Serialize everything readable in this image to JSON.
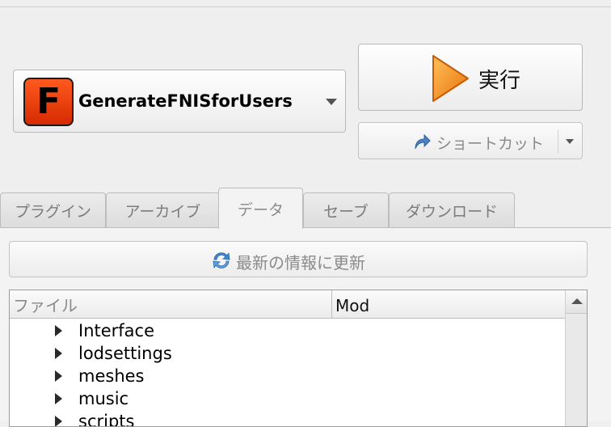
{
  "executable": {
    "logo_letter": "F",
    "selected": "GenerateFNISforUsers"
  },
  "run_button": {
    "label": "実行"
  },
  "shortcut_button": {
    "label": "ショートカット"
  },
  "tabs": [
    {
      "label": "プラグイン",
      "active": false
    },
    {
      "label": "アーカイブ",
      "active": false
    },
    {
      "label": "データ",
      "active": true
    },
    {
      "label": "セーブ",
      "active": false
    },
    {
      "label": "ダウンロード",
      "active": false
    }
  ],
  "data_panel": {
    "refresh_label": "最新の情報に更新",
    "columns": {
      "file": "ファイル",
      "mod": "Mod"
    },
    "rows": [
      {
        "name": "Interface",
        "mod": ""
      },
      {
        "name": "lodsettings",
        "mod": ""
      },
      {
        "name": "meshes",
        "mod": ""
      },
      {
        "name": "music",
        "mod": ""
      },
      {
        "name": "scripts",
        "mod": ""
      }
    ]
  },
  "colors": {
    "background": "#efefef",
    "logo_orange": "#e8420f",
    "run_icon_orange": "#f49a1f",
    "refresh_icon_blue": "#3b8ad8"
  }
}
